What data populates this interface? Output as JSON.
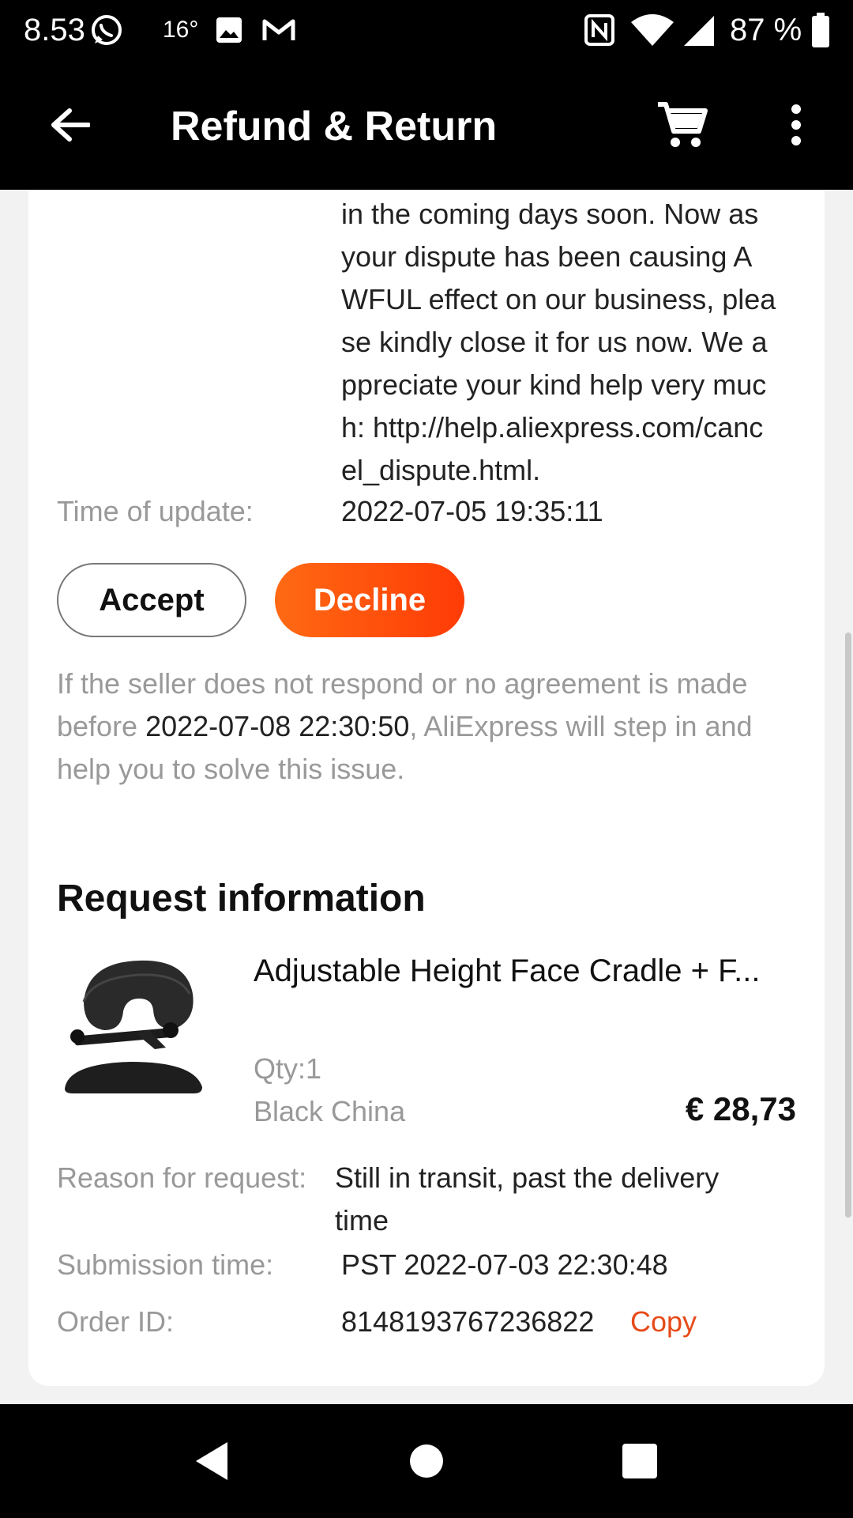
{
  "status_bar": {
    "time": "8.53",
    "temperature": "16°",
    "battery": "87 %",
    "icons": [
      "whatsapp-icon",
      "image-icon",
      "gmail-icon",
      "nfc-icon",
      "wifi-icon",
      "signal-icon",
      "battery-icon"
    ]
  },
  "app_bar": {
    "title": "Refund & Return",
    "icons": [
      "back-arrow-icon",
      "cart-icon",
      "more-vert-icon"
    ]
  },
  "negotiation": {
    "message": "in the coming days soon. Now as\nyour dispute has been causing A\nWFUL effect on our business, plea\nse kindly close it for us now. We a\nppreciate your kind help very muc\nh: http://help.aliexpress.com/canc\nel_dispute.html.",
    "update_label": "Time of update:",
    "update_value": "2022-07-05 19:35:11",
    "accept_label": "Accept",
    "decline_label": "Decline",
    "notice_prefix": "If the seller does not respond or no agreement is made before ",
    "notice_deadline": "2022-07-08 22:30:50",
    "notice_suffix": ", AliExpress will step in and help you to solve this issue."
  },
  "request_info": {
    "title": "Request information",
    "product_name": "Adjustable Height Face Cradle + F...",
    "qty": "Qty:1",
    "variant": "Black China",
    "price": "€ 28,73",
    "reason_label": "Reason for request:",
    "reason_value": "Still in transit, past the delivery time",
    "submission_label": "Submission time:",
    "submission_value": "PST 2022-07-03 22:30:48",
    "order_label": "Order ID:",
    "order_value": "8148193767236822",
    "copy_label": "Copy"
  },
  "colors": {
    "accent": "#ff4f0f",
    "copy_link": "#e64a19"
  }
}
